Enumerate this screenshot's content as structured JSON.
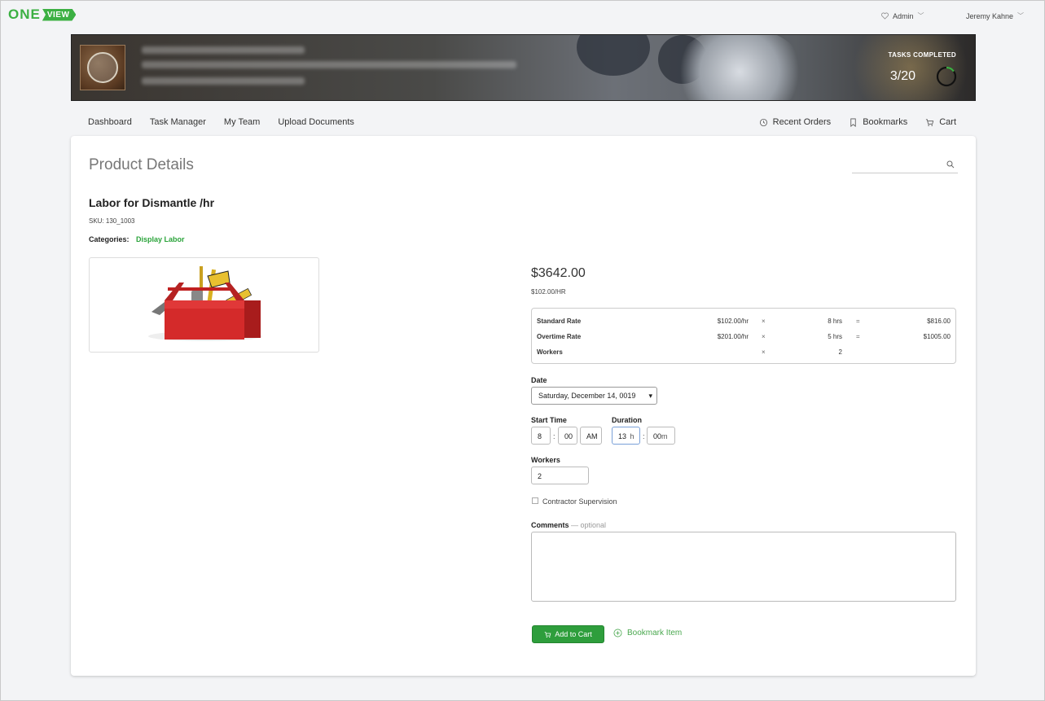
{
  "app": {
    "logo_one": "ONE",
    "logo_view": "VIEW"
  },
  "topbar": {
    "admin_label": "Admin",
    "user_name": "Jeremy Kahne"
  },
  "banner": {
    "tasks_label": "TASKS COMPLETED",
    "tasks_value": "3/20",
    "tasks_fraction": 0.15
  },
  "nav": {
    "left": [
      "Dashboard",
      "Task Manager",
      "My Team",
      "Upload Documents"
    ],
    "recent_orders": "Recent Orders",
    "bookmarks": "Bookmarks",
    "cart": "Cart"
  },
  "page": {
    "title": "Product Details",
    "product_name": "Labor for Dismantle /hr",
    "sku": "SKU: 130_1003",
    "categories_label": "Categories:",
    "category": "Display Labor",
    "price": "$3642.00",
    "rate": "$102.00/HR"
  },
  "rates": [
    {
      "label": "Standard Rate",
      "rate": "$102.00/hr",
      "x": "×",
      "qty": "8 hrs",
      "eq": "=",
      "total": "$816.00"
    },
    {
      "label": "Overtime Rate",
      "rate": "$201.00/hr",
      "x": "×",
      "qty": "5 hrs",
      "eq": "=",
      "total": "$1005.00"
    },
    {
      "label": "Workers",
      "rate": "",
      "x": "×",
      "qty": "2",
      "eq": "",
      "total": ""
    }
  ],
  "form": {
    "date_label": "Date",
    "date_value": "Saturday, December 14, 0019",
    "start_time_label": "Start Time",
    "start_hour": "8",
    "start_minute": "00",
    "start_ampm": "AM",
    "duration_label": "Duration",
    "duration_hours": "13",
    "duration_hours_unit": "h",
    "duration_minutes": "00",
    "duration_minutes_unit": "m",
    "workers_label": "Workers",
    "workers_value": "2",
    "contractor_label": "Contractor Supervision",
    "comments_label": "Comments",
    "comments_optional": "— optional",
    "add_to_cart": "Add to Cart",
    "bookmark_item": "Bookmark Item"
  },
  "colors": {
    "brand_green": "#3cb043",
    "button_green": "#2e9e3c",
    "link_green": "#2aa33a"
  }
}
